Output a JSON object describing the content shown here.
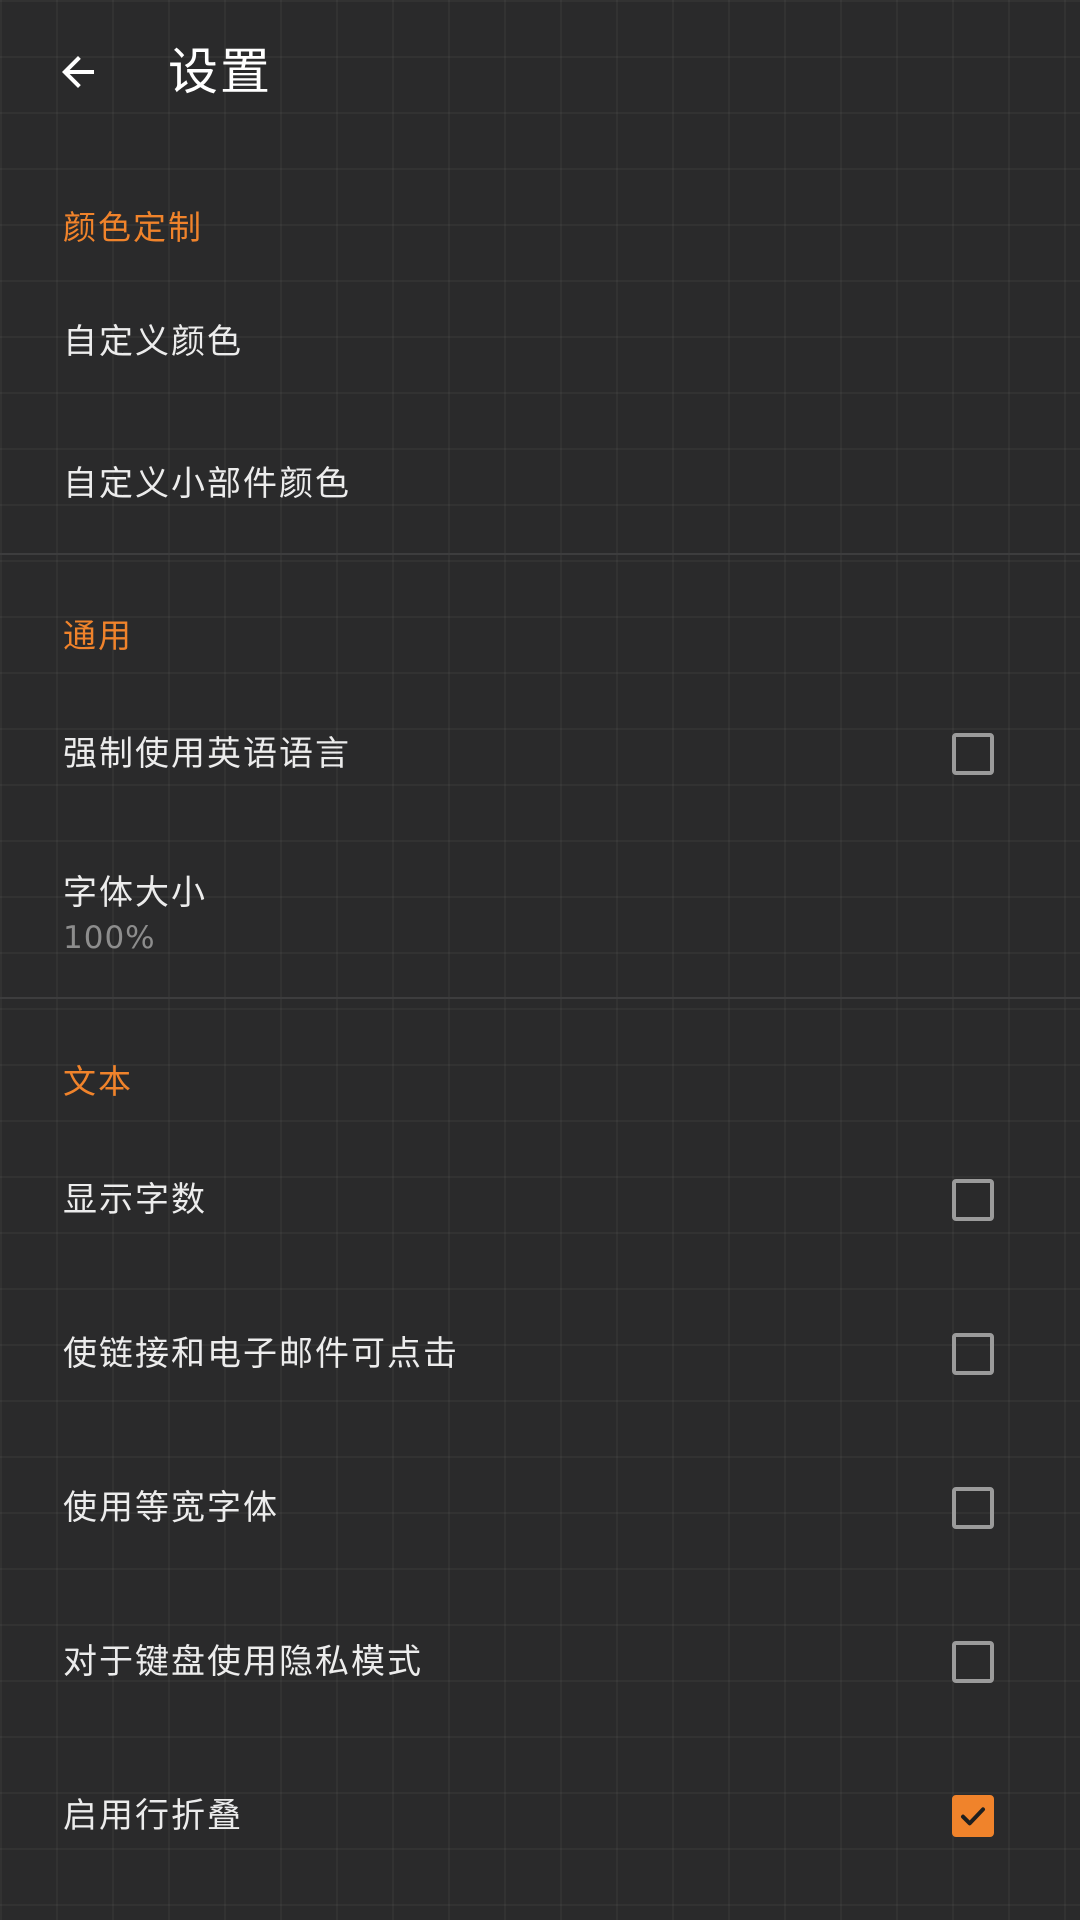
{
  "toolbar": {
    "title": "设置",
    "back_icon": "arrow-back-icon"
  },
  "colors": {
    "accent": "#f0832b",
    "background": "#2a2a2b",
    "text_primary": "#ececec",
    "text_secondary": "#8d8d8d",
    "checkbox_border": "#9b9b9b"
  },
  "sections": {
    "color": {
      "header": "颜色定制",
      "items": [
        {
          "title": "自定义颜色"
        },
        {
          "title": "自定义小部件颜色"
        }
      ]
    },
    "general": {
      "header": "通用",
      "items": [
        {
          "title": "强制使用英语语言",
          "checked": false
        },
        {
          "title": "字体大小",
          "summary": "100%"
        }
      ]
    },
    "text": {
      "header": "文本",
      "items": [
        {
          "title": "显示字数",
          "checked": false
        },
        {
          "title": "使链接和电子邮件可点击",
          "checked": false
        },
        {
          "title": "使用等宽字体",
          "checked": false
        },
        {
          "title": "对于键盘使用隐私模式",
          "checked": false
        },
        {
          "title": "启用行折叠",
          "checked": true
        }
      ]
    }
  }
}
